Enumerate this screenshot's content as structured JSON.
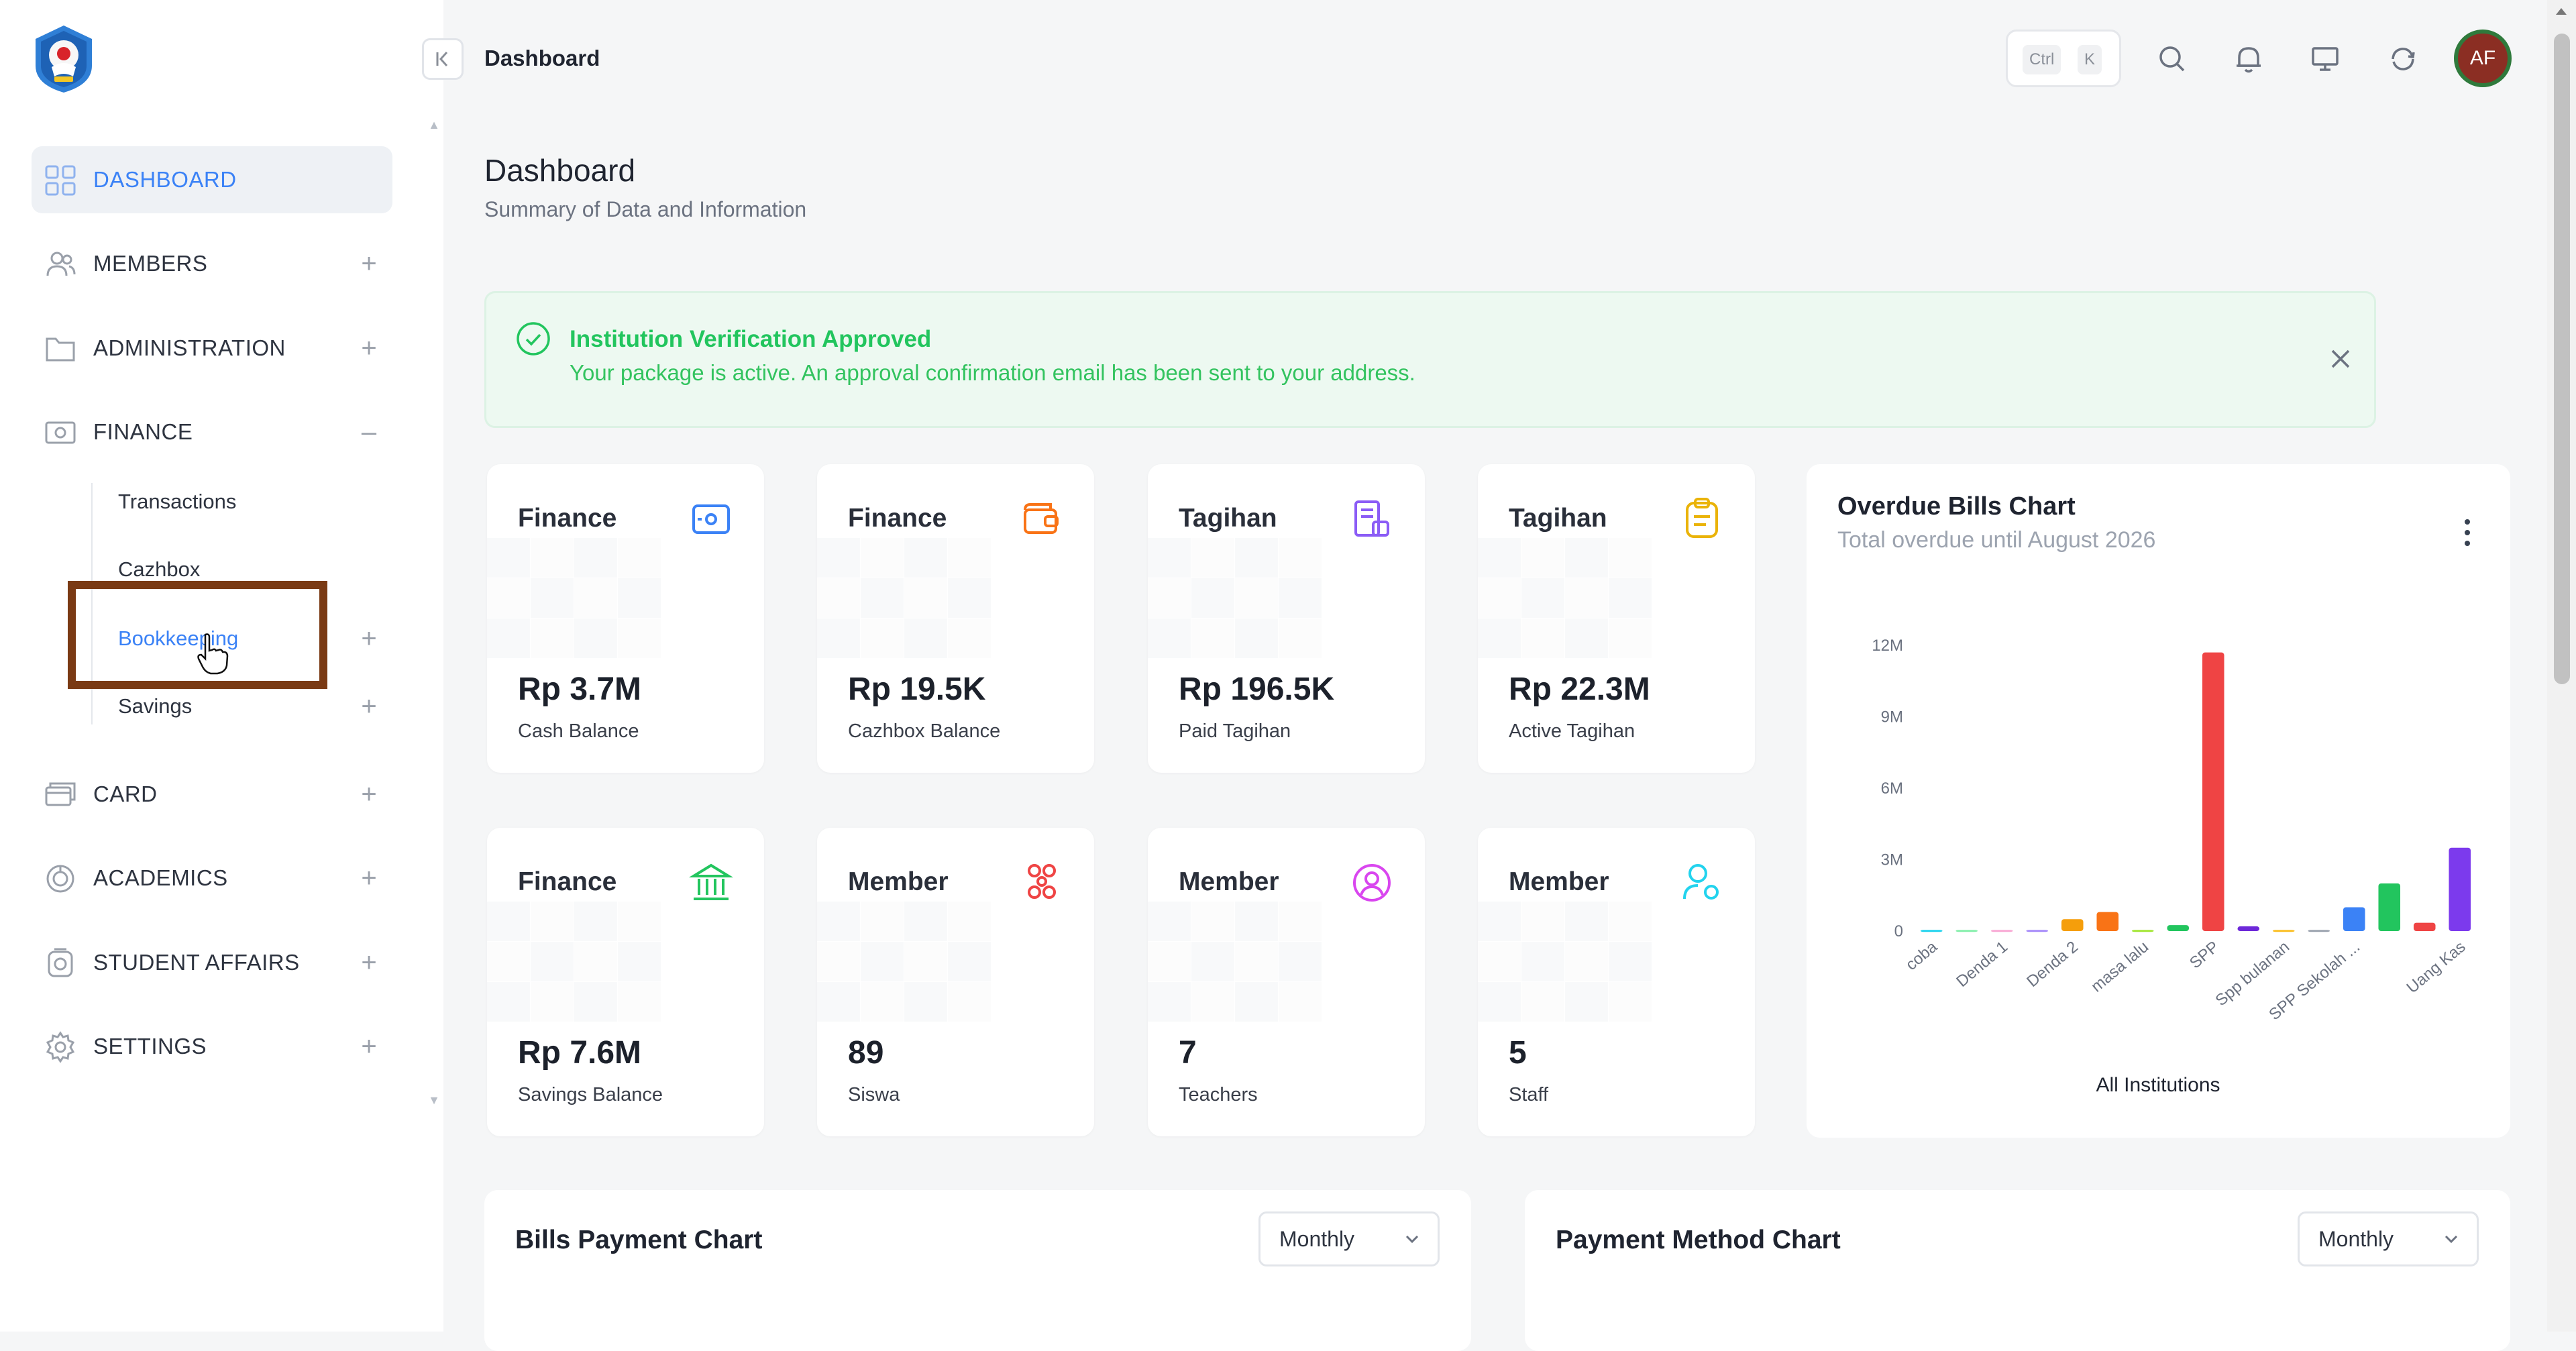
{
  "sidebar": {
    "items": [
      {
        "label": "DASHBOARD",
        "icon": "grid-icon"
      },
      {
        "label": "MEMBERS",
        "icon": "users-icon",
        "toggle": "+"
      },
      {
        "label": "ADMINISTRATION",
        "icon": "folder-icon",
        "toggle": "+"
      },
      {
        "label": "FINANCE",
        "icon": "money-icon",
        "toggle": "–"
      },
      {
        "label": "CARD",
        "icon": "card-icon",
        "toggle": "+"
      },
      {
        "label": "ACADEMICS",
        "icon": "academics-icon",
        "toggle": "+"
      },
      {
        "label": "STUDENT AFFAIRS",
        "icon": "student-icon",
        "toggle": "+"
      },
      {
        "label": "SETTINGS",
        "icon": "gear-icon",
        "toggle": "+"
      }
    ],
    "finance_sub": [
      {
        "label": "Transactions"
      },
      {
        "label": "Cazhbox"
      },
      {
        "label": "Bookkeeping",
        "toggle": "+"
      },
      {
        "label": "Savings",
        "toggle": "+"
      }
    ]
  },
  "topbar": {
    "title": "Dashboard",
    "shortcut_keys": [
      "Ctrl",
      "K"
    ],
    "avatar_initials": "AF"
  },
  "page": {
    "title": "Dashboard",
    "subtitle": "Summary of Data and Information"
  },
  "alert": {
    "title": "Institution Verification Approved",
    "message": "Your package is active. An approval confirmation email has been sent to your address."
  },
  "cards": [
    {
      "title": "Finance",
      "value": "Rp 3.7M",
      "label": "Cash Balance",
      "icon": "safe-icon",
      "color": "#3b82f6"
    },
    {
      "title": "Finance",
      "value": "Rp 19.5K",
      "label": "Cazhbox Balance",
      "icon": "wallet-icon",
      "color": "#f97316"
    },
    {
      "title": "Tagihan",
      "value": "Rp 196.5K",
      "label": "Paid Tagihan",
      "icon": "bill-icon",
      "color": "#8b5cf6"
    },
    {
      "title": "Tagihan",
      "value": "Rp 22.3M",
      "label": "Active Tagihan",
      "icon": "clipboard-icon",
      "color": "#eab308"
    },
    {
      "title": "Finance",
      "value": "Rp 7.6M",
      "label": "Savings Balance",
      "icon": "bank-icon",
      "color": "#22c55e"
    },
    {
      "title": "Member",
      "value": "89",
      "label": "Siswa",
      "icon": "group-icon",
      "color": "#ef4444"
    },
    {
      "title": "Member",
      "value": "7",
      "label": "Teachers",
      "icon": "user-circle-icon",
      "color": "#d946ef"
    },
    {
      "title": "Member",
      "value": "5",
      "label": "Staff",
      "icon": "user-settings-icon",
      "color": "#22d3ee"
    }
  ],
  "overdue_chart": {
    "title": "Overdue Bills Chart",
    "subtitle": "Total overdue until August 2026"
  },
  "chart_data": {
    "type": "bar",
    "categories": [
      "coba",
      "",
      "Denda 1",
      "",
      "Denda 2",
      "",
      "masa lalu",
      "",
      "SPP",
      "",
      "Spp bulanan",
      "",
      "SPP Sekolah ...",
      "",
      "Uang Kas"
    ],
    "values": [
      0.05,
      0.05,
      0.05,
      0.05,
      0.5,
      0.8,
      0.05,
      0.25,
      11.7,
      0.2,
      0.05,
      0.05,
      1.0,
      2.0,
      3.5
    ],
    "extra_bar_before_last": 0.35,
    "colors": [
      "#22d3ee",
      "#86efac",
      "#f9a8d4",
      "#a78bfa",
      "#f59e0b",
      "#f97316",
      "#a3e635",
      "#22c55e",
      "#ef4444",
      "#6d28d9",
      "#fbbf24",
      "#9ca3af",
      "#3b82f6",
      "#22c55e",
      "#7c3aed"
    ],
    "yticks": [
      "0",
      "3M",
      "6M",
      "9M",
      "12M"
    ],
    "ylim": [
      0,
      12
    ],
    "xlabel": "All Institutions",
    "ylabel": ""
  },
  "bottom": {
    "bills_title": "Bills Payment Chart",
    "bills_select": "Monthly",
    "method_title": "Payment Method Chart",
    "method_select": "Monthly"
  }
}
